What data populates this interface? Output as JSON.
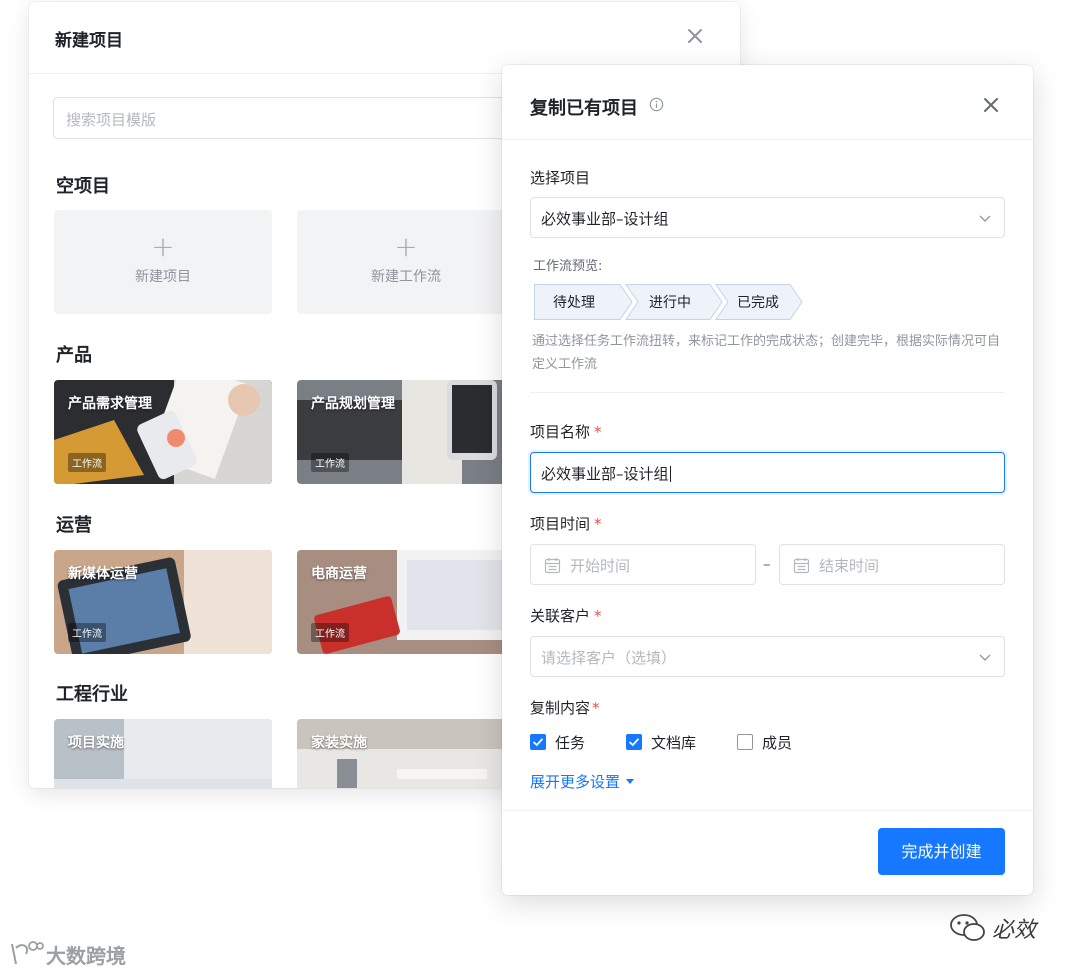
{
  "back_dialog": {
    "title": "新建项目",
    "search_placeholder": "搜索项目模版",
    "sections": {
      "empty": "空项目",
      "product": "产品",
      "operations": "运营",
      "engineering": "工程行业"
    },
    "empty_cards": [
      "新建项目",
      "新建工作流"
    ],
    "cards": {
      "product_1": "产品需求管理",
      "product_2": "产品规划管理",
      "ops_1": "新媒体运营",
      "ops_2": "电商运营",
      "eng_1": "项目实施",
      "eng_2": "家装实施"
    },
    "tag": "工作流"
  },
  "front_dialog": {
    "title": "复制已有项目",
    "select_project": {
      "label": "选择项目",
      "value": "必效事业部–设计组"
    },
    "workflow_preview": {
      "label": "工作流预览:",
      "steps": [
        "待处理",
        "进行中",
        "已完成"
      ],
      "help": "通过选择任务工作流扭转，来标记工作的完成状态；创建完毕，根据实际情况可自定义工作流"
    },
    "project_name": {
      "label": "项目名称",
      "value": "必效事业部–设计组"
    },
    "project_time": {
      "label": "项目时间",
      "start_placeholder": "开始时间",
      "separator": "–",
      "end_placeholder": "结束时间"
    },
    "customer": {
      "label": "关联客户",
      "placeholder": "请选择客户（选填）"
    },
    "copy_content": {
      "label": "复制内容",
      "options": [
        {
          "label": "任务",
          "checked": true
        },
        {
          "label": "文档库",
          "checked": true
        },
        {
          "label": "成员",
          "checked": false
        }
      ]
    },
    "required_mark": "*",
    "more_settings": "展开更多设置",
    "submit": "完成并创建"
  },
  "colors": {
    "accent": "#1677ff",
    "required": "#f54a45"
  },
  "watermarks": {
    "right": "必效",
    "left": "大数跨境"
  }
}
